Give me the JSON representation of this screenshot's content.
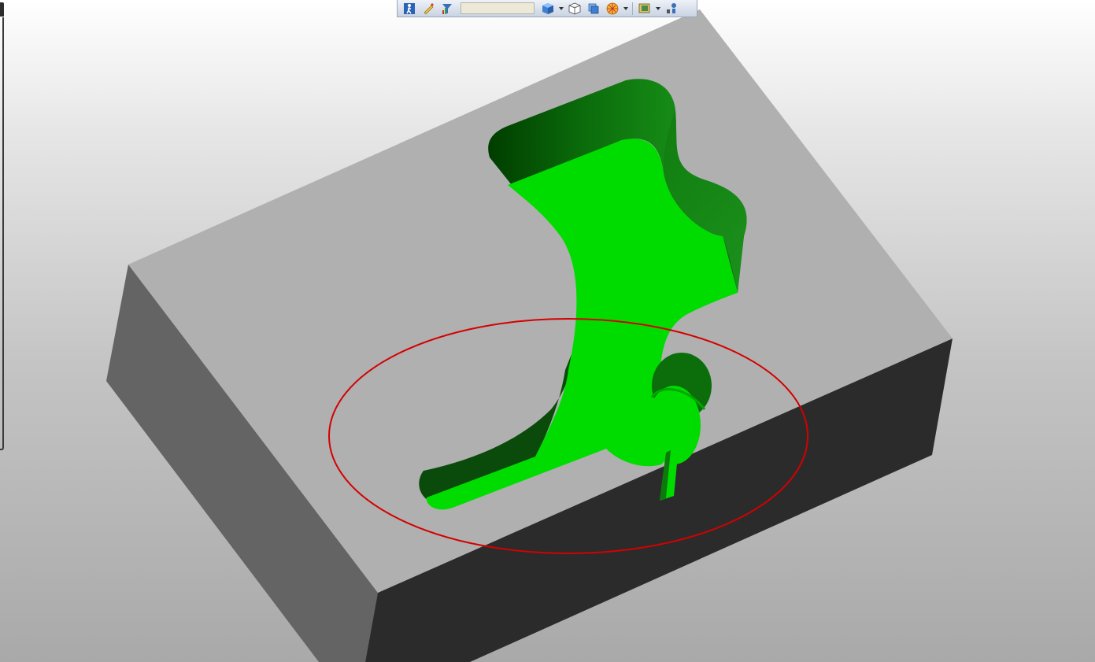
{
  "window": {
    "type": "3d-cad-viewport"
  },
  "toolbar": {
    "search_value": "",
    "buttons": [
      {
        "id": "walkthrough",
        "icon": "walk-person-icon"
      },
      {
        "id": "measure",
        "icon": "pencil-ruler-icon"
      },
      {
        "id": "filter",
        "icon": "funnel-filter-icon"
      },
      {
        "id": "view-orientation",
        "icon": "blue-cube-icon",
        "has_dropdown": true
      },
      {
        "id": "wireframe",
        "icon": "wire-cube-icon"
      },
      {
        "id": "display-style",
        "icon": "shaded-cube-icon"
      },
      {
        "id": "appearance",
        "icon": "color-sphere-icon",
        "has_dropdown": true
      },
      {
        "id": "scene",
        "icon": "scene-monitor-icon",
        "has_dropdown": true
      },
      {
        "id": "light",
        "icon": "light-bulb-icon"
      }
    ]
  },
  "scene": {
    "part_color": "#b0b0b0",
    "side_left_color": "#646464",
    "side_front_color": "#2b2b2b",
    "cavity_highlight_color": "#00dc00",
    "cavity_wall_color": "#0b6e0b",
    "annotation_ellipse_color": "#d40000",
    "annotation": "red-ellipse-markup"
  }
}
